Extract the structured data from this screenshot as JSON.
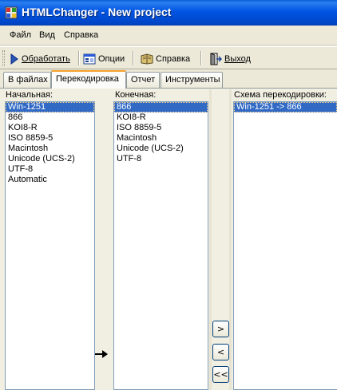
{
  "window": {
    "title": "HTMLChanger - New project",
    "app_icon": "htmlchanger-app-icon"
  },
  "menu": [
    "Файл",
    "Вид",
    "Справка"
  ],
  "toolbar": {
    "process": {
      "label": "Обработать",
      "icon": "play-arrow-icon"
    },
    "options": {
      "label": "Опции",
      "icon": "options-icon"
    },
    "help": {
      "label": "Справка",
      "icon": "book-icon"
    },
    "exit": {
      "label": "Выход",
      "icon": "exit-door-icon"
    }
  },
  "tabs": [
    {
      "label": "В файлах",
      "active": false
    },
    {
      "label": "Перекодировка",
      "active": true
    },
    {
      "label": "Отчет",
      "active": false
    },
    {
      "label": "Инструменты",
      "active": false
    }
  ],
  "source": {
    "label": "Начальная:",
    "items": [
      "Win-1251",
      "866",
      "KOI8-R",
      "ISO 8859-5",
      "Macintosh",
      "Unicode (UCS-2)",
      "UTF-8",
      "Automatic"
    ],
    "selected": 0
  },
  "target": {
    "label": "Конечная:",
    "items": [
      "866",
      "KOI8-R",
      "ISO 8859-5",
      "Macintosh",
      "Unicode (UCS-2)",
      "UTF-8"
    ],
    "selected": 0
  },
  "scheme": {
    "label": "Схема перекодировки:",
    "items": [
      "Win-1251 -> 866"
    ],
    "selected": 0
  },
  "buttons": {
    "add": ">",
    "remove": "<",
    "remove_all": "<<"
  },
  "colors": {
    "titlebar": "#0054e3",
    "selection": "#316ac5",
    "active_tab_accent": "#f6a12c",
    "panel": "#f1efe2"
  }
}
